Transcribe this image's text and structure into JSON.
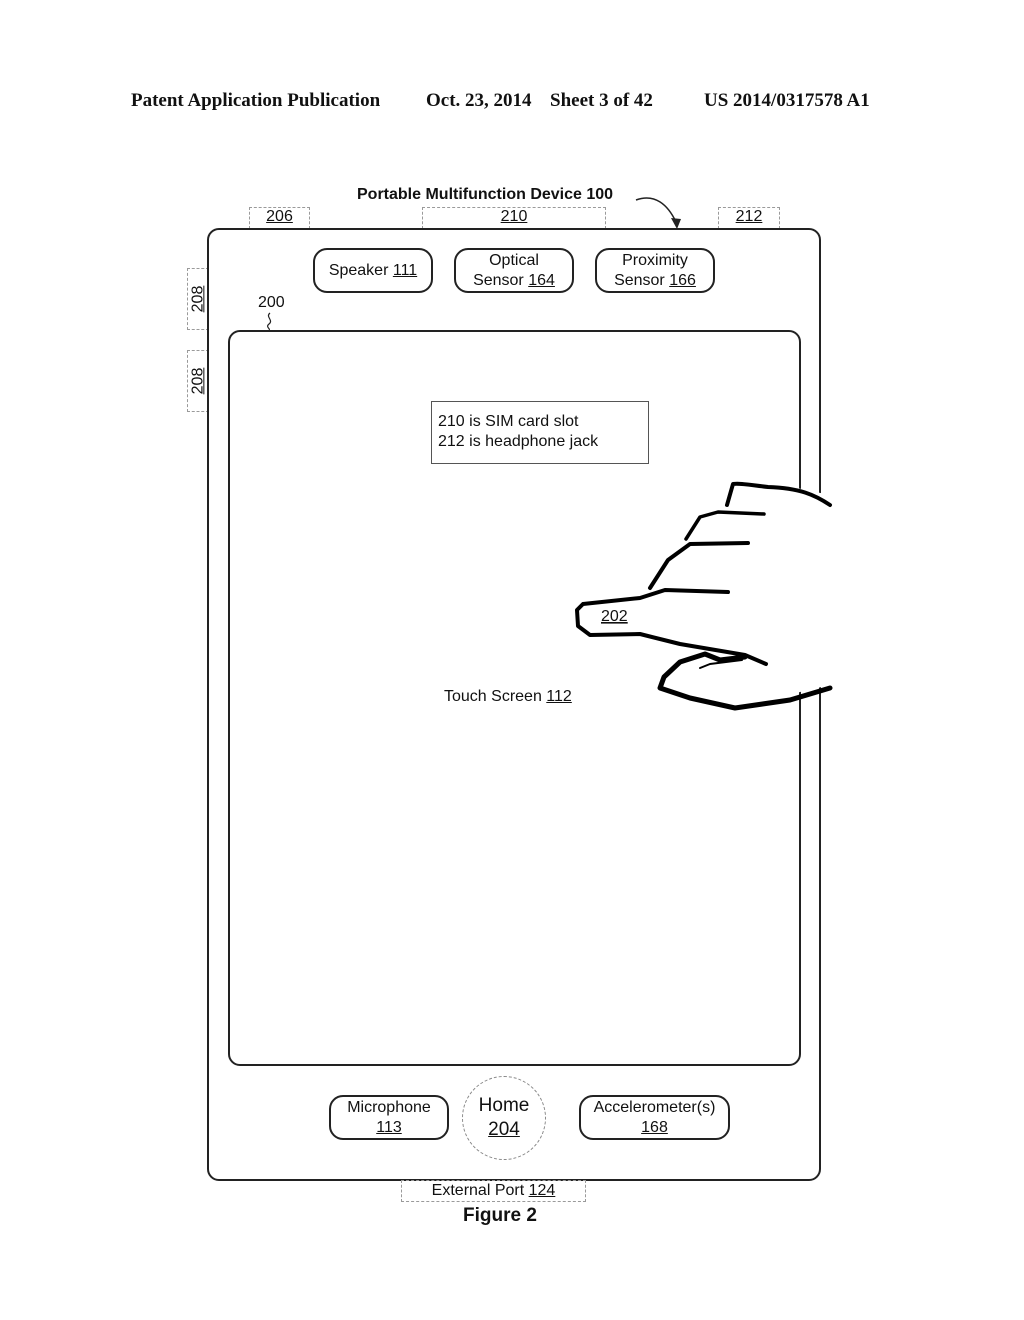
{
  "header": {
    "publication": "Patent Application Publication",
    "date": "Oct. 23, 2014",
    "sheet": "Sheet 3 of 42",
    "patent_number": "US 2014/0317578 A1"
  },
  "figure": {
    "device_title": "Portable Multifunction Device 100",
    "caption": "Figure 2",
    "ref_labels": {
      "r206": "206",
      "r210": "210",
      "r212": "212",
      "r208a": "208",
      "r208b": "208",
      "r200": "200",
      "r202": "202"
    },
    "top_components": [
      {
        "name": "Speaker",
        "ref": "111"
      },
      {
        "name": "Optical",
        "name2": "Sensor",
        "ref": "164"
      },
      {
        "name": "Proximity",
        "name2": "Sensor",
        "ref": "166"
      }
    ],
    "note": {
      "line1": "210 is SIM card slot",
      "line2": "212 is headphone jack"
    },
    "touch_screen": {
      "name": "Touch Screen",
      "ref": "112"
    },
    "bottom_components": [
      {
        "name": "Microphone",
        "ref": "113"
      },
      {
        "name": "Home",
        "ref": "204"
      },
      {
        "name": "Accelerometer(s)",
        "ref": "168"
      }
    ],
    "external_port": {
      "name": "External Port",
      "ref": "124"
    }
  }
}
